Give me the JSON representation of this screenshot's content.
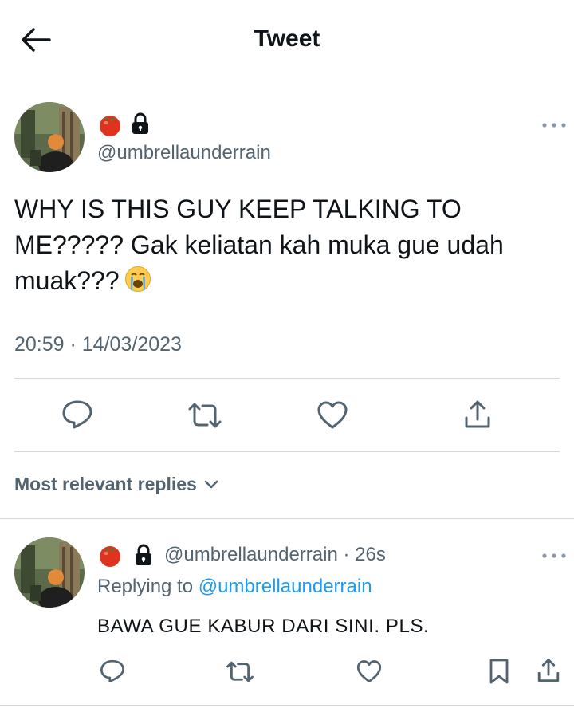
{
  "header": {
    "title": "Tweet"
  },
  "tweet": {
    "author_emojis": [
      "tomato-emoji",
      "lock-icon"
    ],
    "handle": "@umbrellaunderrain",
    "text": "WHY IS THIS GUY KEEP TALKING TO ME????? Gak keliatan kah muka gue udah muak???",
    "timestamp": "20:59 · 14/03/2023"
  },
  "replies_section": {
    "label": "Most relevant replies"
  },
  "reply": {
    "handle_time": "@umbrellaunderrain · 26s",
    "replying_prefix": "Replying to",
    "replying_handle": "@umbrellaunderrain",
    "text": "BAWA GUE KABUR DARI SINI. PLS."
  },
  "colors": {
    "text": "#0f1419",
    "secondary": "#536471",
    "link": "#1d9bf0",
    "divider": "#cfd9de"
  }
}
